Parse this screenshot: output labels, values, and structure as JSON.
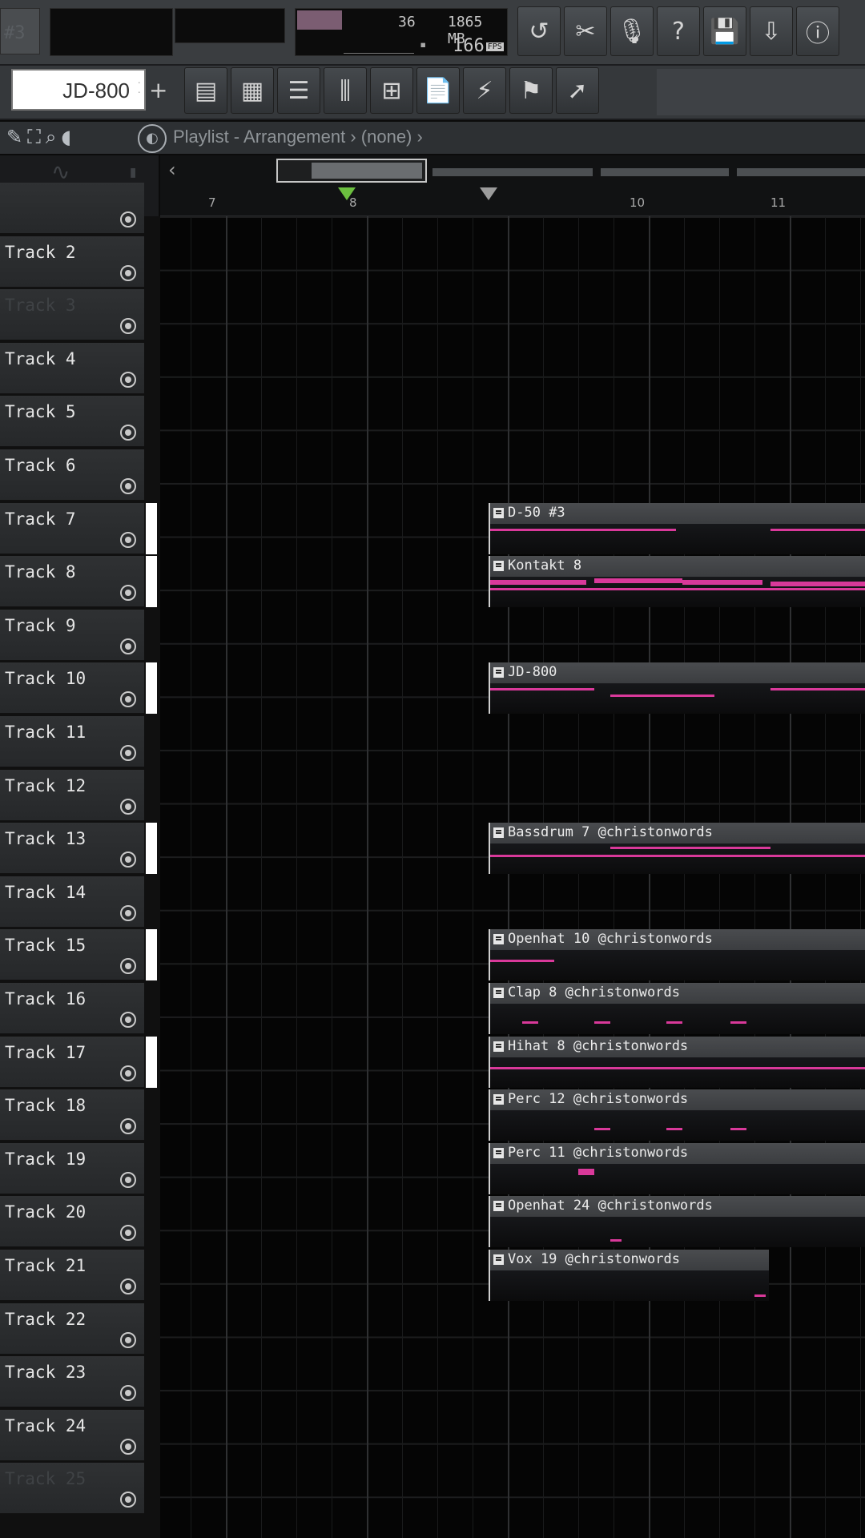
{
  "toolbar": {
    "corner_text": "#3",
    "cpu": "36",
    "memory": "1865 MB",
    "polyphony": "166",
    "polyphony_unit": "FPS",
    "buttons": [
      {
        "name": "undo-icon",
        "glyph": "↺"
      },
      {
        "name": "cut-icon",
        "glyph": "✂"
      },
      {
        "name": "mic-icon",
        "glyph": "🎙"
      },
      {
        "name": "help-icon",
        "glyph": "?"
      },
      {
        "name": "save-icon",
        "glyph": "💾"
      },
      {
        "name": "export-icon",
        "glyph": "⇩"
      },
      {
        "name": "info-icon",
        "glyph": "ⓘ"
      }
    ]
  },
  "toolbar2": {
    "preset_name": "JD-800",
    "add_label": "+",
    "buttons": [
      {
        "name": "piano-roll-icon",
        "glyph": "▤"
      },
      {
        "name": "step-sequencer-icon",
        "glyph": "▦"
      },
      {
        "name": "channel-rack-icon",
        "glyph": "☰"
      },
      {
        "name": "mixer-icon",
        "glyph": "⫼"
      },
      {
        "name": "browser-icon",
        "glyph": "⊞"
      },
      {
        "name": "clipboard-icon",
        "glyph": "📄"
      },
      {
        "name": "plugin-icon",
        "glyph": "⚡"
      },
      {
        "name": "lamp-icon",
        "glyph": "⚑"
      },
      {
        "name": "tools-icon",
        "glyph": "➚"
      }
    ]
  },
  "playlist": {
    "title": "Playlist - Arrangement",
    "pattern": "(none)",
    "separator": "›"
  },
  "ruler": {
    "bars": [
      {
        "label": "7"
      },
      {
        "label": "8"
      },
      {
        "label": "10"
      },
      {
        "label": "11"
      }
    ]
  },
  "tracks": [
    {
      "name": "",
      "dim": true
    },
    {
      "name": "Track 2"
    },
    {
      "name": "Track 3",
      "dim": true
    },
    {
      "name": "Track 4"
    },
    {
      "name": "Track 5"
    },
    {
      "name": "Track 6"
    },
    {
      "name": "Track 7",
      "handle": true
    },
    {
      "name": "Track 8",
      "handle": true
    },
    {
      "name": "Track 9"
    },
    {
      "name": "Track 10",
      "handle": true
    },
    {
      "name": "Track 11"
    },
    {
      "name": "Track 12"
    },
    {
      "name": "Track 13",
      "handle": true
    },
    {
      "name": "Track 14"
    },
    {
      "name": "Track 15",
      "handle": true
    },
    {
      "name": "Track 16"
    },
    {
      "name": "Track 17",
      "handle": true
    },
    {
      "name": "Track 18"
    },
    {
      "name": "Track 19"
    },
    {
      "name": "Track 20"
    },
    {
      "name": "Track 21"
    },
    {
      "name": "Track 22"
    },
    {
      "name": "Track 23"
    },
    {
      "name": "Track 24"
    },
    {
      "name": "Track 25",
      "dim": true
    }
  ],
  "clips": [
    {
      "track": 6,
      "label": "D-50 #3"
    },
    {
      "track": 7,
      "label": "Kontakt 8"
    },
    {
      "track": 9,
      "label": "JD-800"
    },
    {
      "track": 12,
      "label": "Bassdrum 7 @christonwords"
    },
    {
      "track": 14,
      "label": "Openhat 10 @christonwords"
    },
    {
      "track": 15,
      "label": "Clap 8 @christonwords"
    },
    {
      "track": 16,
      "label": "Hihat 8 @christonwords"
    },
    {
      "track": 17,
      "label": "Perc 12 @christonwords"
    },
    {
      "track": 18,
      "label": "Perc 11 @christonwords"
    },
    {
      "track": 19,
      "label": "Openhat 24 @christonwords"
    },
    {
      "track": 20,
      "label": "Vox 19 @christonwords",
      "short": true
    }
  ],
  "colors": {
    "note": "#d9399a",
    "playhead_marker": "#6cbf3f",
    "background": "#050505"
  }
}
